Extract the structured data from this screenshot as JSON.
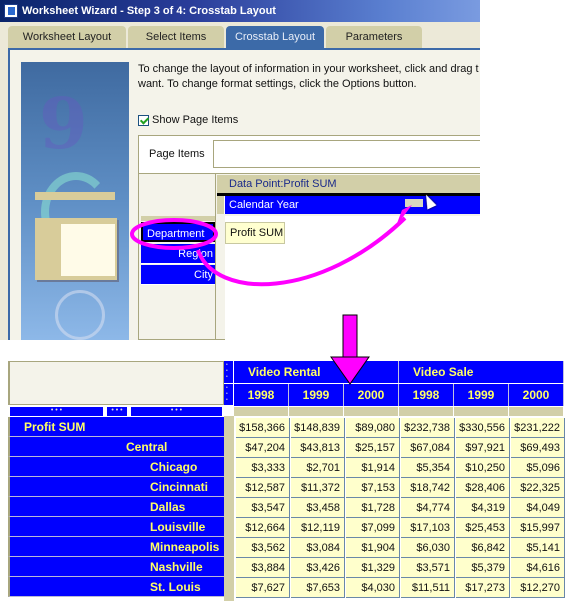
{
  "window": {
    "title": "Worksheet Wizard - Step 3 of 4: Crosstab Layout",
    "icon": "wizard-app-icon"
  },
  "tabs": [
    {
      "label": "Worksheet Layout",
      "active": false
    },
    {
      "label": "Select Items",
      "active": false
    },
    {
      "label": "Crosstab Layout",
      "active": true
    },
    {
      "label": "Parameters",
      "active": false
    }
  ],
  "instructions": {
    "line1": "To change the layout of information in your worksheet, click and drag t",
    "line2": "want. To change format settings, click the Options button."
  },
  "show_page_items": {
    "label": "Show Page Items",
    "checked": true
  },
  "layout": {
    "page_items_label": "Page Items",
    "data_point_label": "Data Point:Profit SUM",
    "column_item": "Calendar Year",
    "row_items": [
      "Department",
      "Region",
      "City"
    ],
    "data_cell": "Profit SUM"
  },
  "annotation": {
    "color": "#FF00FF",
    "highlight": "Department",
    "arrow_meaning": "drag Department to column axis"
  },
  "crosstab": {
    "groups": [
      "Video Rental",
      "Video Sale"
    ],
    "years": [
      "1998",
      "1999",
      "2000",
      "1998",
      "1999",
      "2000"
    ],
    "row_handle_glyph": "• • •",
    "rows": [
      {
        "label": "Profit SUM",
        "level": 0,
        "values": [
          "$158,366",
          "$148,839",
          "$89,080",
          "$232,738",
          "$330,556",
          "$231,222"
        ]
      },
      {
        "label": "Central",
        "level": 1,
        "values": [
          "$47,204",
          "$43,813",
          "$25,157",
          "$67,084",
          "$97,921",
          "$69,493"
        ]
      },
      {
        "label": "Chicago",
        "level": 2,
        "values": [
          "$3,333",
          "$2,701",
          "$1,914",
          "$5,354",
          "$10,250",
          "$5,096"
        ]
      },
      {
        "label": "Cincinnati",
        "level": 2,
        "values": [
          "$12,587",
          "$11,372",
          "$7,153",
          "$18,742",
          "$28,406",
          "$22,325"
        ]
      },
      {
        "label": "Dallas",
        "level": 2,
        "values": [
          "$3,547",
          "$3,458",
          "$1,728",
          "$4,774",
          "$4,319",
          "$4,049"
        ]
      },
      {
        "label": "Louisville",
        "level": 2,
        "values": [
          "$12,664",
          "$12,119",
          "$7,099",
          "$17,103",
          "$25,453",
          "$15,997"
        ]
      },
      {
        "label": "Minneapolis",
        "level": 2,
        "values": [
          "$3,562",
          "$3,084",
          "$1,904",
          "$6,030",
          "$6,842",
          "$5,141"
        ]
      },
      {
        "label": "Nashville",
        "level": 2,
        "values": [
          "$3,884",
          "$3,426",
          "$1,329",
          "$3,571",
          "$5,379",
          "$4,616"
        ]
      },
      {
        "label": "St. Louis",
        "level": 2,
        "values": [
          "$7,627",
          "$7,653",
          "$4,030",
          "$11,511",
          "$17,273",
          "$12,270"
        ]
      }
    ]
  },
  "colors": {
    "header_blue": "#0000FF",
    "header_text": "#FFFF66",
    "cell_bg": "#FFFFCC",
    "tab_active": "#3C6AA8",
    "tab_inactive": "#D2CFA8",
    "annotation": "#FF00FF"
  }
}
